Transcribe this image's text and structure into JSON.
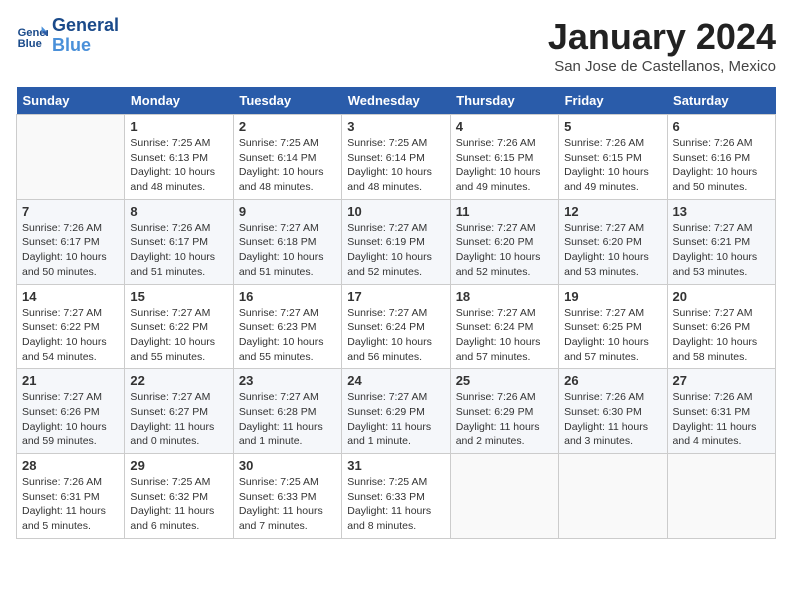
{
  "header": {
    "logo_line1": "General",
    "logo_line2": "Blue",
    "month_title": "January 2024",
    "location": "San Jose de Castellanos, Mexico"
  },
  "days_of_week": [
    "Sunday",
    "Monday",
    "Tuesday",
    "Wednesday",
    "Thursday",
    "Friday",
    "Saturday"
  ],
  "weeks": [
    [
      {
        "num": "",
        "info": ""
      },
      {
        "num": "1",
        "info": "Sunrise: 7:25 AM\nSunset: 6:13 PM\nDaylight: 10 hours\nand 48 minutes."
      },
      {
        "num": "2",
        "info": "Sunrise: 7:25 AM\nSunset: 6:14 PM\nDaylight: 10 hours\nand 48 minutes."
      },
      {
        "num": "3",
        "info": "Sunrise: 7:25 AM\nSunset: 6:14 PM\nDaylight: 10 hours\nand 48 minutes."
      },
      {
        "num": "4",
        "info": "Sunrise: 7:26 AM\nSunset: 6:15 PM\nDaylight: 10 hours\nand 49 minutes."
      },
      {
        "num": "5",
        "info": "Sunrise: 7:26 AM\nSunset: 6:15 PM\nDaylight: 10 hours\nand 49 minutes."
      },
      {
        "num": "6",
        "info": "Sunrise: 7:26 AM\nSunset: 6:16 PM\nDaylight: 10 hours\nand 50 minutes."
      }
    ],
    [
      {
        "num": "7",
        "info": "Sunrise: 7:26 AM\nSunset: 6:17 PM\nDaylight: 10 hours\nand 50 minutes."
      },
      {
        "num": "8",
        "info": "Sunrise: 7:26 AM\nSunset: 6:17 PM\nDaylight: 10 hours\nand 51 minutes."
      },
      {
        "num": "9",
        "info": "Sunrise: 7:27 AM\nSunset: 6:18 PM\nDaylight: 10 hours\nand 51 minutes."
      },
      {
        "num": "10",
        "info": "Sunrise: 7:27 AM\nSunset: 6:19 PM\nDaylight: 10 hours\nand 52 minutes."
      },
      {
        "num": "11",
        "info": "Sunrise: 7:27 AM\nSunset: 6:20 PM\nDaylight: 10 hours\nand 52 minutes."
      },
      {
        "num": "12",
        "info": "Sunrise: 7:27 AM\nSunset: 6:20 PM\nDaylight: 10 hours\nand 53 minutes."
      },
      {
        "num": "13",
        "info": "Sunrise: 7:27 AM\nSunset: 6:21 PM\nDaylight: 10 hours\nand 53 minutes."
      }
    ],
    [
      {
        "num": "14",
        "info": "Sunrise: 7:27 AM\nSunset: 6:22 PM\nDaylight: 10 hours\nand 54 minutes."
      },
      {
        "num": "15",
        "info": "Sunrise: 7:27 AM\nSunset: 6:22 PM\nDaylight: 10 hours\nand 55 minutes."
      },
      {
        "num": "16",
        "info": "Sunrise: 7:27 AM\nSunset: 6:23 PM\nDaylight: 10 hours\nand 55 minutes."
      },
      {
        "num": "17",
        "info": "Sunrise: 7:27 AM\nSunset: 6:24 PM\nDaylight: 10 hours\nand 56 minutes."
      },
      {
        "num": "18",
        "info": "Sunrise: 7:27 AM\nSunset: 6:24 PM\nDaylight: 10 hours\nand 57 minutes."
      },
      {
        "num": "19",
        "info": "Sunrise: 7:27 AM\nSunset: 6:25 PM\nDaylight: 10 hours\nand 57 minutes."
      },
      {
        "num": "20",
        "info": "Sunrise: 7:27 AM\nSunset: 6:26 PM\nDaylight: 10 hours\nand 58 minutes."
      }
    ],
    [
      {
        "num": "21",
        "info": "Sunrise: 7:27 AM\nSunset: 6:26 PM\nDaylight: 10 hours\nand 59 minutes."
      },
      {
        "num": "22",
        "info": "Sunrise: 7:27 AM\nSunset: 6:27 PM\nDaylight: 11 hours\nand 0 minutes."
      },
      {
        "num": "23",
        "info": "Sunrise: 7:27 AM\nSunset: 6:28 PM\nDaylight: 11 hours\nand 1 minute."
      },
      {
        "num": "24",
        "info": "Sunrise: 7:27 AM\nSunset: 6:29 PM\nDaylight: 11 hours\nand 1 minute."
      },
      {
        "num": "25",
        "info": "Sunrise: 7:26 AM\nSunset: 6:29 PM\nDaylight: 11 hours\nand 2 minutes."
      },
      {
        "num": "26",
        "info": "Sunrise: 7:26 AM\nSunset: 6:30 PM\nDaylight: 11 hours\nand 3 minutes."
      },
      {
        "num": "27",
        "info": "Sunrise: 7:26 AM\nSunset: 6:31 PM\nDaylight: 11 hours\nand 4 minutes."
      }
    ],
    [
      {
        "num": "28",
        "info": "Sunrise: 7:26 AM\nSunset: 6:31 PM\nDaylight: 11 hours\nand 5 minutes."
      },
      {
        "num": "29",
        "info": "Sunrise: 7:25 AM\nSunset: 6:32 PM\nDaylight: 11 hours\nand 6 minutes."
      },
      {
        "num": "30",
        "info": "Sunrise: 7:25 AM\nSunset: 6:33 PM\nDaylight: 11 hours\nand 7 minutes."
      },
      {
        "num": "31",
        "info": "Sunrise: 7:25 AM\nSunset: 6:33 PM\nDaylight: 11 hours\nand 8 minutes."
      },
      {
        "num": "",
        "info": ""
      },
      {
        "num": "",
        "info": ""
      },
      {
        "num": "",
        "info": ""
      }
    ]
  ]
}
